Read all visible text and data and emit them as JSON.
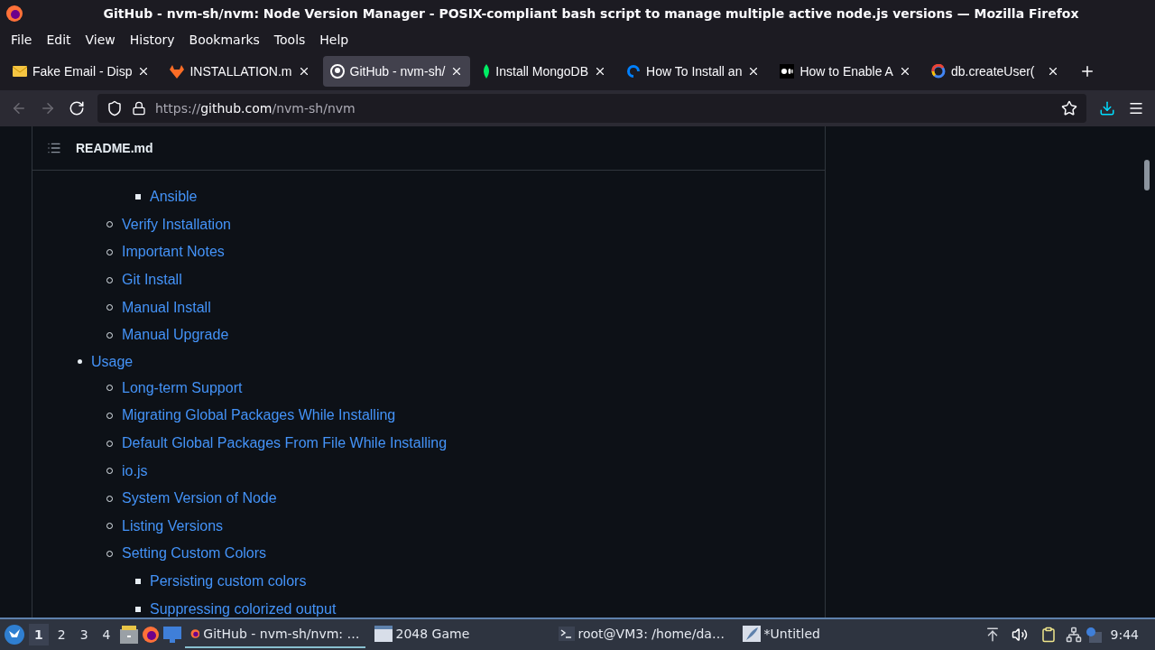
{
  "window": {
    "title": "GitHub - nvm-sh/nvm: Node Version Manager - POSIX-compliant bash script to manage multiple active node.js versions — Mozilla Firefox"
  },
  "menu": [
    "File",
    "Edit",
    "View",
    "History",
    "Bookmarks",
    "Tools",
    "Help"
  ],
  "tabs": [
    {
      "label": "Fake Email - Disp",
      "selected": false
    },
    {
      "label": "INSTALLATION.m",
      "selected": false
    },
    {
      "label": "GitHub - nvm-sh/",
      "selected": true
    },
    {
      "label": "Install MongoDB",
      "selected": false
    },
    {
      "label": "How To Install an",
      "selected": false
    },
    {
      "label": "How to Enable A",
      "selected": false
    },
    {
      "label": "db.createUser(",
      "selected": false
    }
  ],
  "address": {
    "prefix": "https://",
    "host": "github.com",
    "path": "/nvm-sh/nvm"
  },
  "readme": {
    "title": "README.md"
  },
  "toc": [
    {
      "children": [
        {
          "children": [
            {
              "label": "Ansible"
            }
          ]
        },
        {
          "label": "Verify Installation"
        },
        {
          "label": "Important Notes"
        },
        {
          "label": "Git Install"
        },
        {
          "label": "Manual Install"
        },
        {
          "label": "Manual Upgrade"
        }
      ]
    },
    {
      "label": "Usage",
      "children": [
        {
          "label": "Long-term Support"
        },
        {
          "label": "Migrating Global Packages While Installing"
        },
        {
          "label": "Default Global Packages From File While Installing"
        },
        {
          "label": "io.js"
        },
        {
          "label": "System Version of Node"
        },
        {
          "label": "Listing Versions"
        },
        {
          "label": "Setting Custom Colors",
          "children": [
            {
              "label": "Persisting custom colors"
            },
            {
              "label": "Suppressing colorized output"
            }
          ]
        }
      ]
    }
  ],
  "taskbar": {
    "workspaces": [
      {
        "label": "1",
        "selected": true
      },
      {
        "label": "2",
        "selected": false
      },
      {
        "label": "3",
        "selected": false
      },
      {
        "label": "4",
        "selected": false
      }
    ],
    "tasks": [
      {
        "label": "GitHub - nvm-sh/nvm: …",
        "selected": true
      },
      {
        "label": "2048 Game",
        "selected": false
      },
      {
        "label": "root@VM3: /home/da…",
        "selected": false
      },
      {
        "label": "*Untitled",
        "selected": false
      }
    ],
    "clock": "9:44"
  }
}
